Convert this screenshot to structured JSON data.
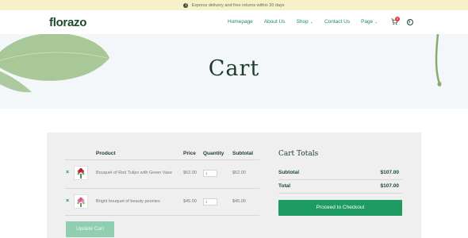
{
  "topbar": {
    "message": "Express delivery and free returns within 30 days"
  },
  "header": {
    "logo": "florazo",
    "nav": [
      {
        "label": "Homepage",
        "has_dropdown": false
      },
      {
        "label": "About Us",
        "has_dropdown": false
      },
      {
        "label": "Shop",
        "has_dropdown": true
      },
      {
        "label": "Contact Us",
        "has_dropdown": false
      },
      {
        "label": "Page",
        "has_dropdown": true
      }
    ],
    "cart_count": "0",
    "icons": [
      "cart-icon",
      "user-icon",
      "info-icon",
      "chevron-down-icon",
      "remove-icon"
    ]
  },
  "hero": {
    "title": "Cart"
  },
  "cart": {
    "headers": {
      "product": "Product",
      "price": "Price",
      "quantity": "Quantity",
      "subtotal": "Subtotal"
    },
    "items": [
      {
        "name": "Bouquet of Red Tulips with Green Vase",
        "price": "$62.00",
        "quantity": "1",
        "subtotal": "$62.00",
        "remove": "×"
      },
      {
        "name": "Bright bouquet of beauty peonies",
        "price": "$45.00",
        "quantity": "1",
        "subtotal": "$45.00",
        "remove": "×"
      }
    ],
    "update_label": "Update Cart"
  },
  "totals": {
    "title": "Cart Totals",
    "subtotal_label": "Subtotal",
    "subtotal_value": "$107.00",
    "total_label": "Total",
    "total_value": "$107.00",
    "checkout_label": "Proceed to Checkout"
  },
  "colors": {
    "accent": "#1e9a63",
    "dark_green": "#1c3d2a",
    "topbar_bg": "#f7f1c9",
    "panel_bg": "#efefef",
    "badge": "#e23b3b"
  }
}
